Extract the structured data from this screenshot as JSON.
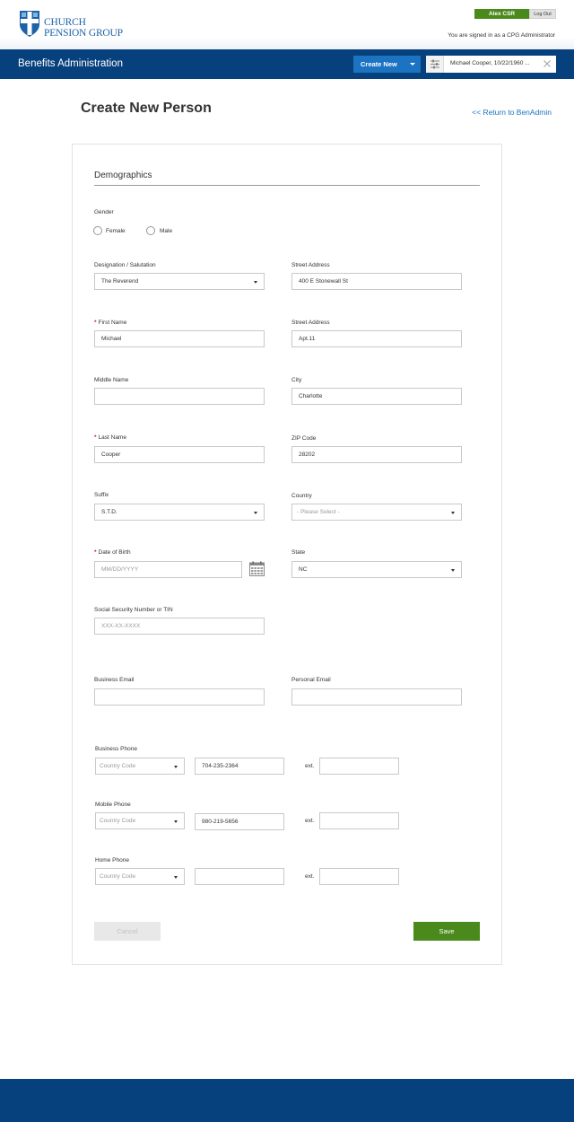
{
  "header": {
    "logo_line1": "CHURCH",
    "logo_line2": "PENSION GROUP",
    "user_name": "Alex CSR",
    "logout_label": "Log Out",
    "signed_in_text": "You are signed in as a CPG Administrator"
  },
  "nav": {
    "title": "Benefits Administration",
    "create_new_label": "Create New",
    "search_value": "Michael Cooper, 10/22/1960 ..."
  },
  "page": {
    "title": "Create New Person",
    "return_link": "<< Return to BenAdmin"
  },
  "form": {
    "section_title": "Demographics",
    "gender": {
      "label": "Gender",
      "options": [
        "Female",
        "Male"
      ]
    },
    "designation": {
      "label": "Designation / Salutation",
      "value": "The Reverend"
    },
    "street1": {
      "label": "Street Address",
      "value": "400 E Stonewall St"
    },
    "first_name": {
      "required": "*",
      "label": "First Name",
      "value": "Michael"
    },
    "street2": {
      "label": "Street Address",
      "value": "Apt.11"
    },
    "middle_name": {
      "label": "Middle Name",
      "value": ""
    },
    "city": {
      "label": "City",
      "value": "Charlotte"
    },
    "last_name": {
      "required": "*",
      "label": "Last Name",
      "value": "Cooper"
    },
    "zip": {
      "label": "ZIP Code",
      "value": "28202"
    },
    "suffix": {
      "label": "Suffix",
      "value": "S.T.D."
    },
    "country": {
      "label": "Country",
      "placeholder": "- Please Select -"
    },
    "dob": {
      "required": "*",
      "label": "Date of Birth",
      "placeholder": "MM/DD/YYYY"
    },
    "state": {
      "label": "State",
      "value": "NC"
    },
    "ssn": {
      "label": "Social Security Number or TIN",
      "placeholder": "XXX-XX-XXXX"
    },
    "business_email": {
      "label": "Business Email",
      "value": ""
    },
    "personal_email": {
      "label": "Personal Email",
      "value": ""
    },
    "country_code_placeholder": "Country Code",
    "ext_label": "ext.",
    "business_phone": {
      "label": "Business Phone",
      "number": "704-235-2364",
      "ext": ""
    },
    "mobile_phone": {
      "label": "Mobile Phone",
      "number": "980-219-5656",
      "ext": ""
    },
    "home_phone": {
      "label": "Home Phone",
      "number": "",
      "ext": ""
    },
    "cancel_label": "Cancel",
    "save_label": "Save"
  },
  "colors": {
    "navy": "#07417d",
    "accent_blue": "#1b73c2",
    "green": "#4a8a1d",
    "required_red": "#d21f1f"
  }
}
